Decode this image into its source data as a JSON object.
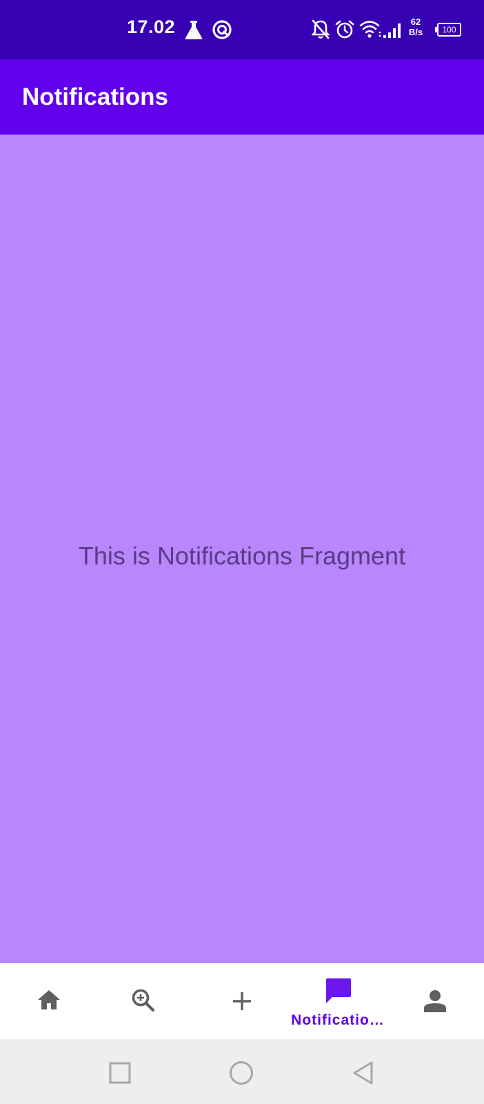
{
  "status_bar": {
    "time": "17.02",
    "net_speed_value": "62",
    "net_speed_unit": "B/s",
    "battery_level": "100",
    "icons": [
      "lab-flask-icon",
      "sync-icon",
      "bell-off-icon",
      "alarm-icon",
      "wifi-icon",
      "signal-icon",
      "battery-icon"
    ]
  },
  "app_bar": {
    "title": "Notifications"
  },
  "content": {
    "message": "This is Notifications Fragment"
  },
  "bottom_nav": {
    "items": [
      {
        "icon": "home-icon",
        "label": "",
        "selected": false
      },
      {
        "icon": "zoom-in-icon",
        "label": "",
        "selected": false
      },
      {
        "icon": "add-icon",
        "label": "",
        "selected": false
      },
      {
        "icon": "chat-bubble-icon",
        "label": "Notificatio…",
        "selected": true
      },
      {
        "icon": "person-icon",
        "label": "",
        "selected": false
      }
    ]
  },
  "system_nav": {
    "buttons": [
      "recents-square-icon",
      "home-circle-icon",
      "back-triangle-icon"
    ]
  },
  "colors": {
    "status_bar": "#3700b3",
    "app_bar": "#6200ee",
    "content_background": "#b986fc",
    "selected_nav": "#6200ee",
    "unselected_nav": "#5f5f5f"
  }
}
